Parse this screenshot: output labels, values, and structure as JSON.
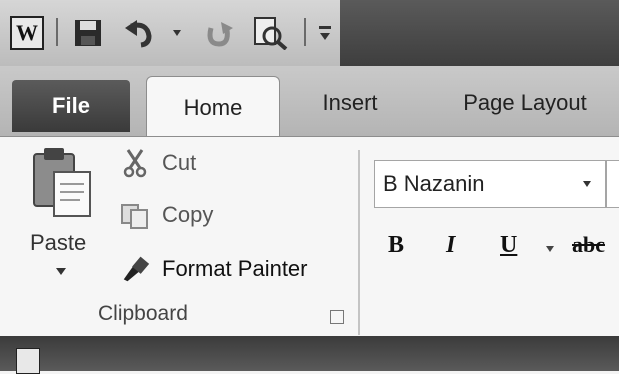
{
  "quick_access": {
    "app_icon_letter": "W",
    "icons": [
      "word-app-icon",
      "save-icon",
      "undo-icon",
      "undo-dropdown-icon",
      "redo-icon",
      "print-preview-icon",
      "customize-qat-icon"
    ]
  },
  "tabs": [
    {
      "label": "File"
    },
    {
      "label": "Home"
    },
    {
      "label": "Insert"
    },
    {
      "label": "Page Layout"
    }
  ],
  "clipboard": {
    "paste_label": "Paste",
    "cut_label": "Cut",
    "copy_label": "Copy",
    "format_painter_label": "Format Painter",
    "group_label": "Clipboard"
  },
  "font": {
    "font_name": "B Nazanin",
    "bold_label": "B",
    "italic_label": "I",
    "underline_label": "U",
    "strike_label": "abc"
  },
  "colors": {
    "file_tab": "#4a4a4a",
    "ribbon_bg": "#f6f6f6"
  }
}
